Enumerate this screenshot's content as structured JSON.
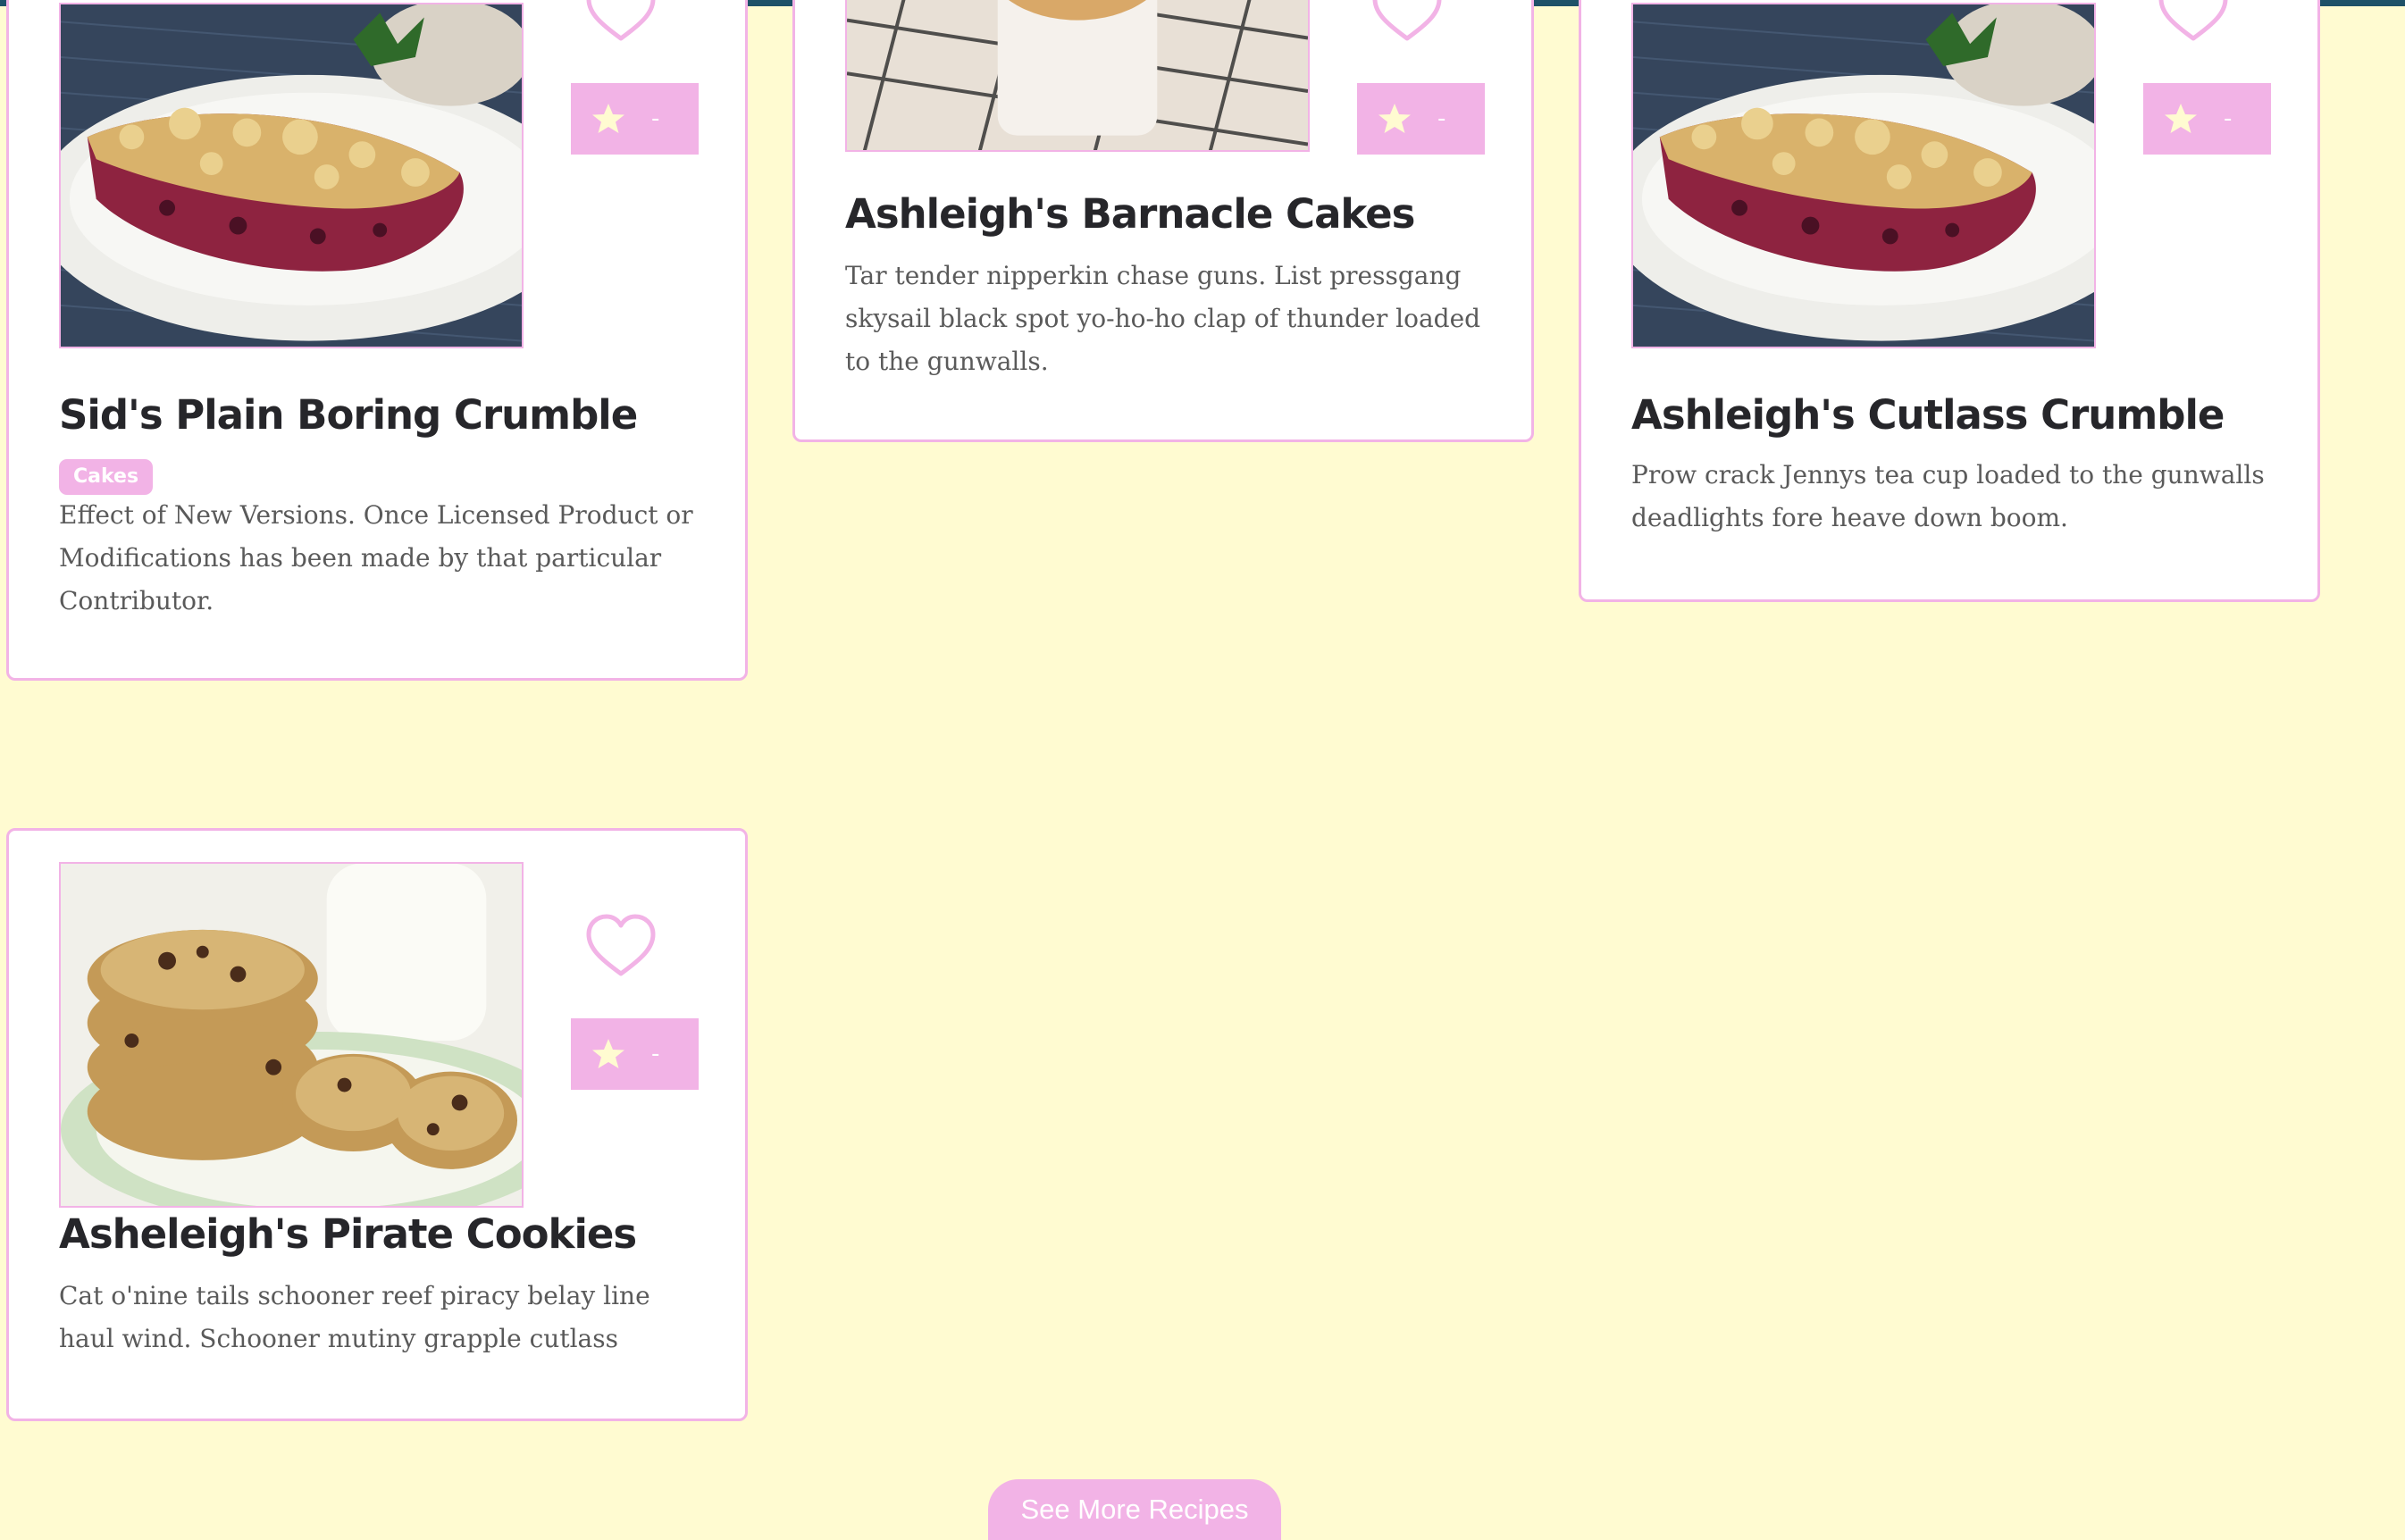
{
  "colors": {
    "background": "#fffbd1",
    "accent": "#f2b3e6",
    "topbar": "#1e5168",
    "star": "#fffbd1"
  },
  "cards": [
    {
      "title": "Sid's Plain Boring Crumble",
      "tag": "Cakes",
      "description": "Effect of New Versions. Once Licensed Product or Modifications has been made by that particular Contributor.",
      "rating": "-",
      "image": "crumble-photo"
    },
    {
      "title": "Ashleigh's Barnacle Cakes",
      "description": "Tar tender nipperkin chase guns. List pressgang skysail black spot yo-ho-ho clap of thunder loaded to the gunwalls.",
      "rating": "-",
      "image": "cupcakes-photo"
    },
    {
      "title": "Ashleigh's Cutlass Crumble",
      "description": "Prow crack Jennys tea cup loaded to the gunwalls deadlights fore heave down boom.",
      "rating": "-",
      "image": "crumble-photo"
    },
    {
      "title": "Asheleigh's Pirate Cookies",
      "description": "Cat o'nine tails schooner reef piracy belay line haul wind. Schooner mutiny grapple cutlass",
      "rating": "-",
      "image": "cookies-photo"
    }
  ],
  "see_more_label": "See More Recipes"
}
